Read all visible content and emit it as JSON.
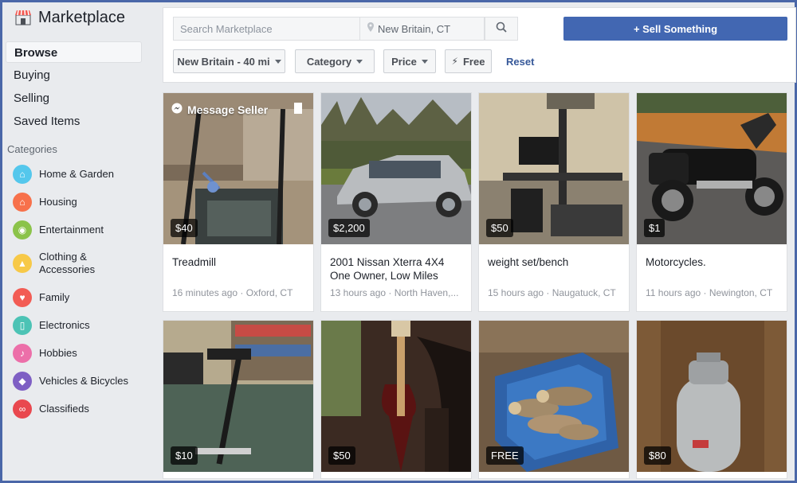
{
  "app": {
    "title": "Marketplace"
  },
  "sidebar": {
    "nav": [
      {
        "label": "Browse",
        "active": true
      },
      {
        "label": "Buying"
      },
      {
        "label": "Selling"
      },
      {
        "label": "Saved Items"
      }
    ],
    "categories_title": "Categories",
    "categories": [
      {
        "label": "Home & Garden",
        "icon": "home-icon",
        "color": "#54c7ec"
      },
      {
        "label": "Housing",
        "icon": "house-icon",
        "color": "#f7714b"
      },
      {
        "label": "Entertainment",
        "icon": "gamepad-icon",
        "color": "#8bc34a"
      },
      {
        "label": "Clothing &",
        "label2": "Accessories",
        "icon": "shirt-icon",
        "color": "#f7c948"
      },
      {
        "label": "Family",
        "icon": "heart-icon",
        "color": "#f25c54"
      },
      {
        "label": "Electronics",
        "icon": "phone-icon",
        "color": "#4cc3b5"
      },
      {
        "label": "Hobbies",
        "icon": "guitar-icon",
        "color": "#ec6fa9"
      },
      {
        "label": "Vehicles & Bicycles",
        "icon": "car-icon",
        "color": "#7e5fc4"
      },
      {
        "label": "Classifieds",
        "icon": "binoculars-icon",
        "color": "#e9484f"
      }
    ]
  },
  "search": {
    "placeholder": "Search Marketplace",
    "location": "New Britain, CT"
  },
  "sell_button": "+ Sell Something",
  "filters": {
    "radius": "New Britain - 40 mi",
    "category": "Category",
    "price": "Price",
    "free": "Free",
    "reset": "Reset"
  },
  "listings": [
    {
      "price": "$40",
      "title": "Treadmill",
      "meta": "16 minutes ago · Oxford, CT",
      "overlay": "Message Seller"
    },
    {
      "price": "$2,200",
      "title": "2001 Nissan Xterra 4X4 One Owner, Low Miles",
      "meta": "13 hours ago · North Haven,..."
    },
    {
      "price": "$50",
      "title": "weight set/bench",
      "meta": "15 hours ago · Naugatuck, CT"
    },
    {
      "price": "$1",
      "title": "Motorcycles.",
      "meta": "11 hours ago · Newington, CT"
    },
    {
      "price": "$10"
    },
    {
      "price": "$50"
    },
    {
      "price": "FREE"
    },
    {
      "price": "$80"
    }
  ],
  "colors": {
    "accent": "#4267b2",
    "frame": "#4a67a8",
    "link": "#365899"
  }
}
